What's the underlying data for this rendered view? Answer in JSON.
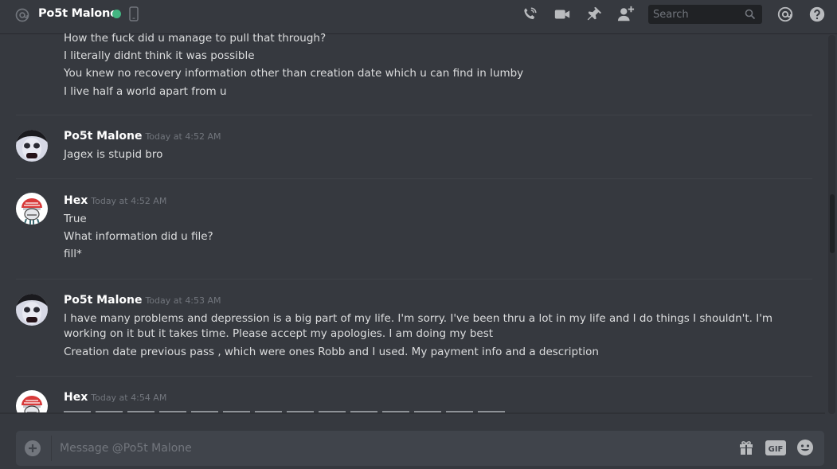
{
  "header": {
    "channel_name": "Po5t Malone",
    "search_placeholder": "Search",
    "status_color": "#43b581",
    "icons": [
      "at-icon",
      "mobile-icon",
      "call-icon",
      "video-icon",
      "pin-icon",
      "add-friend-icon",
      "search-icon",
      "mention-icon",
      "help-icon"
    ]
  },
  "messages": {
    "top_lines": [
      "How the fuck did u manage to pull that through?",
      "I literally didnt think it was possible",
      "You knew no recovery information other than creation date which u can find in lumby",
      "I live half a world apart from u"
    ],
    "groups": [
      {
        "author": "Po5t Malone",
        "timestamp": "Today at 4:52 AM",
        "lines": [
          "Jagex is stupid bro"
        ]
      },
      {
        "author": "Hex",
        "timestamp": "Today at 4:52 AM",
        "lines": [
          "True",
          "What information did u file?",
          "fill*"
        ]
      },
      {
        "author": "Po5t Malone",
        "timestamp": "Today at 4:53 AM",
        "lines": [
          "I have many problems and depression is a big part of my life. I'm sorry. I've been thru a lot in my life and I do things I shouldn't. I'm working on it but it takes time. Please accept my apologies. I am doing my best",
          "Creation date previous pass , which were ones Robb and I used. My payment info and a description"
        ]
      },
      {
        "author": "Hex",
        "timestamp": "Today at 4:54 AM",
        "lines": []
      }
    ]
  },
  "composer": {
    "placeholder": "Message @Po5t Malone",
    "icons": [
      "plus-icon",
      "gift-icon",
      "gif-icon",
      "emoji-icon"
    ]
  }
}
